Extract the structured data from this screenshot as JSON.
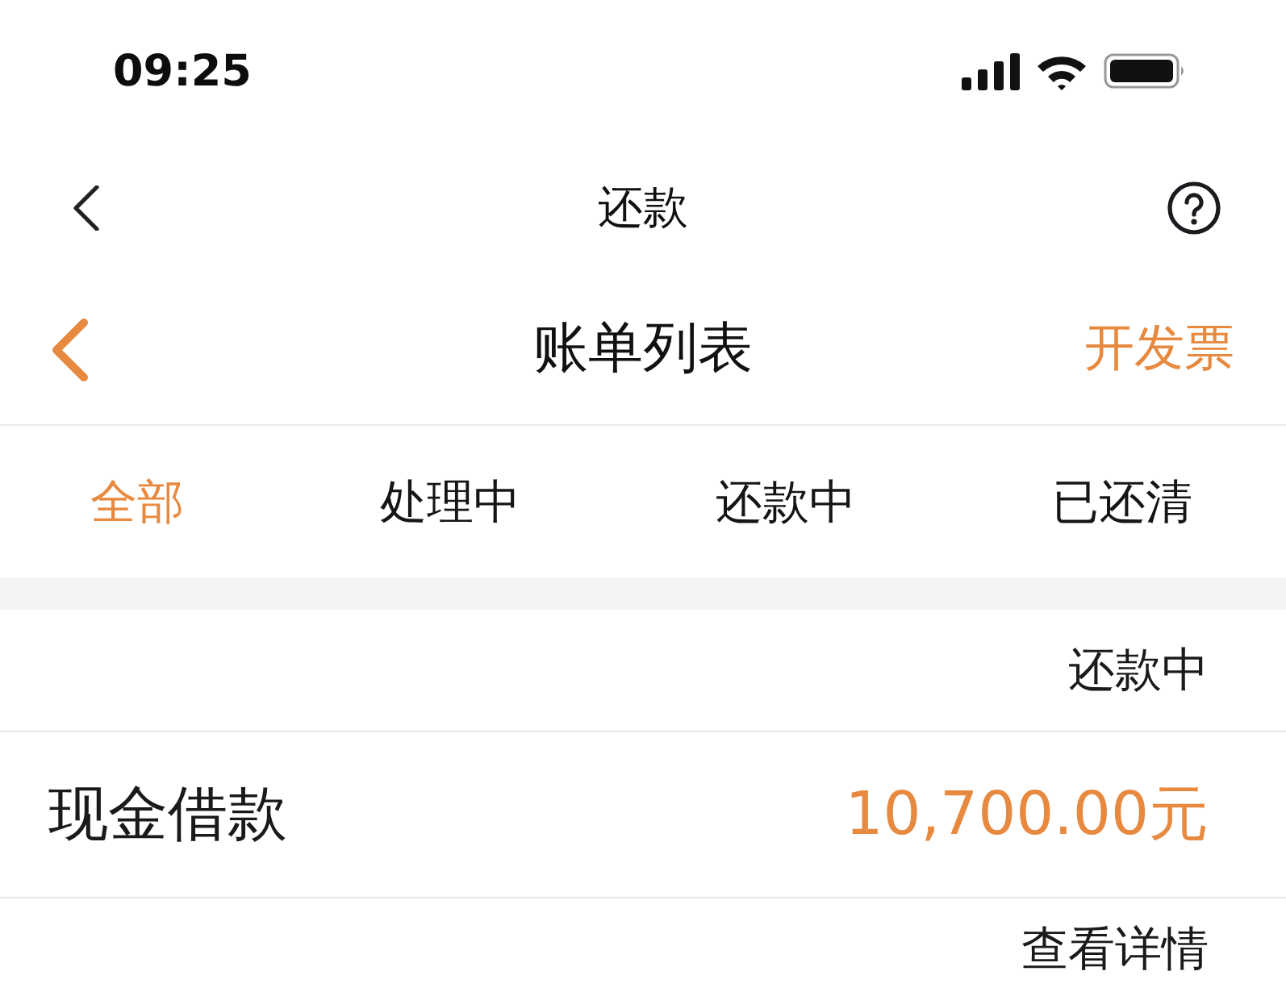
{
  "status_bar": {
    "time": "09:25"
  },
  "top_nav": {
    "title": "还款"
  },
  "sub_nav": {
    "title": "账单列表",
    "action": "开发票"
  },
  "tabs": [
    {
      "label": "全部",
      "selected": true
    },
    {
      "label": "处理中",
      "selected": false
    },
    {
      "label": "还款中",
      "selected": false
    },
    {
      "label": "已还清",
      "selected": false
    }
  ],
  "bill": {
    "status": "还款中",
    "name": "现金借款",
    "amount": "10,700.00元",
    "link": "查看详情"
  }
}
